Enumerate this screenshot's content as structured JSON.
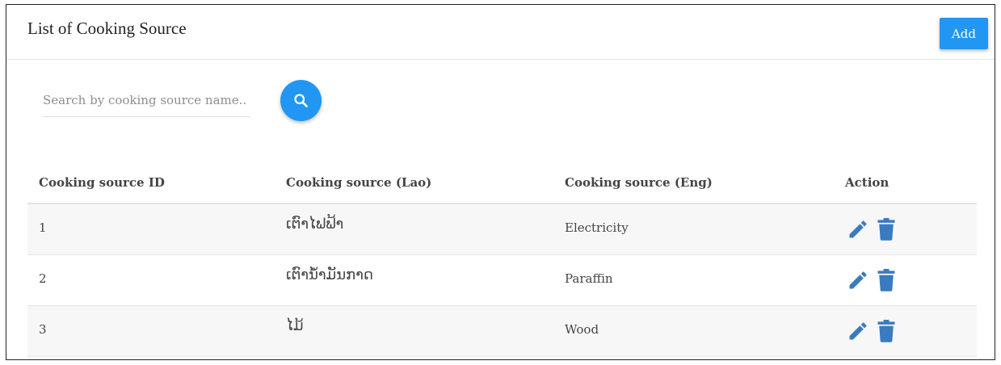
{
  "header": {
    "title": "List of Cooking Source",
    "add_label": "Add"
  },
  "search": {
    "placeholder": "Search by cooking source name..",
    "value": "",
    "button_icon": "search-icon"
  },
  "table": {
    "columns": [
      "Cooking source ID",
      "Cooking source (Lao)",
      "Cooking source (Eng)",
      "Action"
    ],
    "rows": [
      {
        "id": "1",
        "lao": "ເຕົາໄຟຟ້າ",
        "eng": "Electricity"
      },
      {
        "id": "2",
        "lao": "ເຕົານ້ຳມັນກາດ",
        "eng": "Paraffin"
      },
      {
        "id": "3",
        "lao": "ໄມ້",
        "eng": "Wood"
      }
    ],
    "action_icons": [
      "pencil-icon",
      "trash-icon"
    ]
  },
  "colors": {
    "primary": "#2196f3",
    "action_icon": "#3a7bbf",
    "row_stripe": "#f7f7f7"
  }
}
